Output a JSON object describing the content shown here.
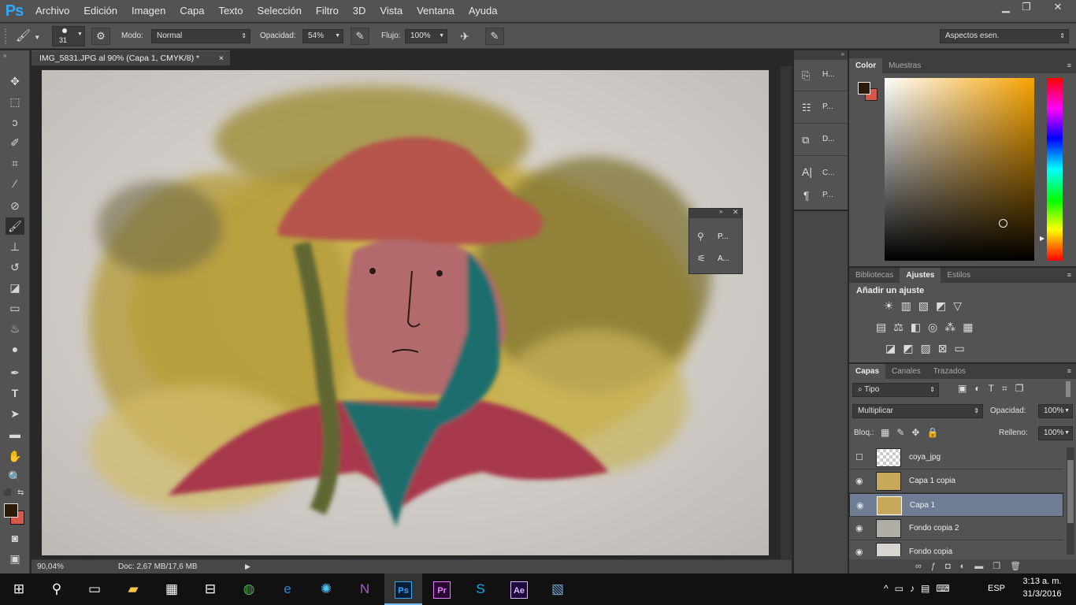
{
  "menu": {
    "logo": "Ps",
    "items": [
      "Archivo",
      "Edición",
      "Imagen",
      "Capa",
      "Texto",
      "Selección",
      "Filtro",
      "3D",
      "Vista",
      "Ventana",
      "Ayuda"
    ]
  },
  "window_controls": {
    "minimize": "▁",
    "restore": "❐",
    "close": "✕"
  },
  "options": {
    "brush_size": "31",
    "mode_label": "Modo:",
    "mode_value": "Normal",
    "opacity_label": "Opacidad:",
    "opacity_value": "54%",
    "flow_label": "Flujo:",
    "flow_value": "100%",
    "workspace": "Aspectos esen."
  },
  "document": {
    "tab_title": "IMG_5831.JPG al 90% (Capa 1, CMYK/8) *",
    "tab_close": "×",
    "zoom": "90,04%",
    "doc_size": "Doc: 2,67 MB/17,6 MB"
  },
  "mid_panels": [
    {
      "icon": "history-icon",
      "label": "H..."
    },
    {
      "icon": "properties-icon",
      "label": "P..."
    },
    {
      "icon": "swatch-icon",
      "label": "D..."
    },
    {
      "icon": "character-icon",
      "label": "C..."
    },
    {
      "icon": "paragraph-icon",
      "label": "P..."
    }
  ],
  "float_panel": [
    {
      "icon": "brush-presets-icon",
      "label": "P..."
    },
    {
      "icon": "brush-settings-icon",
      "label": "A..."
    }
  ],
  "color_panel": {
    "tabs": [
      "Color",
      "Muestras"
    ],
    "foreground": "#2b1a0a",
    "background": "#d9574a",
    "hue_top": "#ff0000"
  },
  "adjust_panel": {
    "tabs": [
      "Bibliotecas",
      "Ajustes",
      "Estilos"
    ],
    "heading": "Añadir un ajuste"
  },
  "layers_panel": {
    "tabs": [
      "Capas",
      "Canales",
      "Trazados"
    ],
    "filter_kind": "Tipo",
    "blend_mode": "Multiplicar",
    "opacity_label": "Opacidad:",
    "opacity_value": "100%",
    "lock_label": "Bloq.:",
    "fill_label": "Relleno:",
    "fill_value": "100%",
    "layers": [
      {
        "name": "coya_jpg",
        "visible": false,
        "selected": false
      },
      {
        "name": "Capa 1 copia",
        "visible": true,
        "selected": false
      },
      {
        "name": "Capa 1",
        "visible": true,
        "selected": true
      },
      {
        "name": "Fondo copia 2",
        "visible": true,
        "selected": false
      },
      {
        "name": "Fondo copia",
        "visible": true,
        "selected": false
      }
    ]
  },
  "taskbar": {
    "apps": [
      "Ps",
      "Pr",
      "Ae"
    ],
    "lang": "ESP",
    "time": "3:13 a. m.",
    "date": "31/3/2016"
  }
}
